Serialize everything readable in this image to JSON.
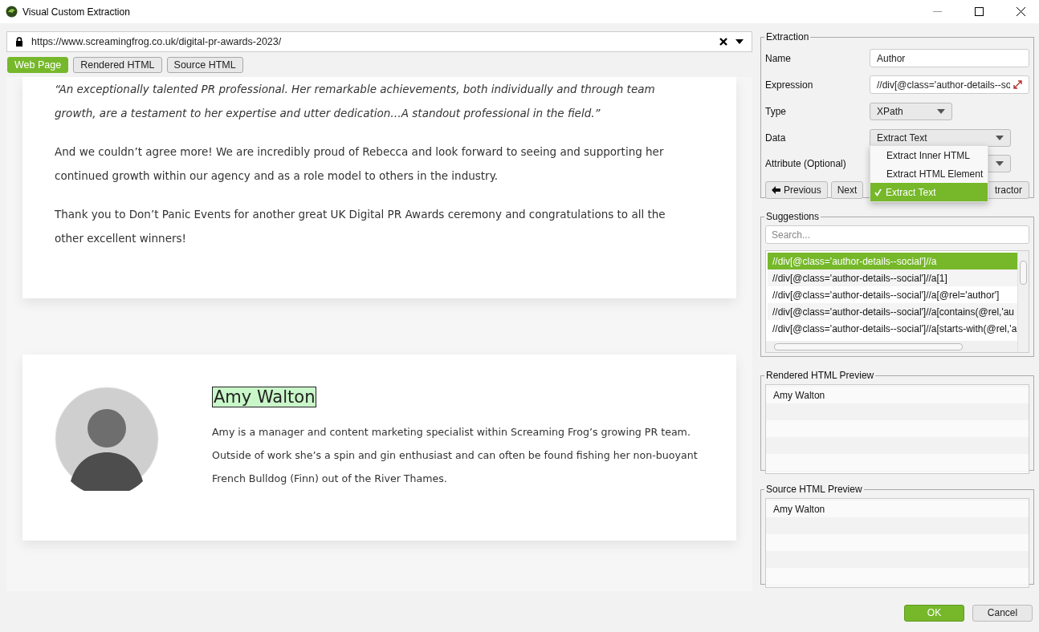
{
  "window": {
    "title": "Visual Custom Extraction"
  },
  "browser": {
    "url": "https://www.screamingfrog.co.uk/digital-pr-awards-2023/",
    "tabs": [
      {
        "label": "Web Page",
        "selected": true
      },
      {
        "label": "Rendered HTML",
        "selected": false
      },
      {
        "label": "Source HTML",
        "selected": false
      }
    ],
    "article": {
      "quote": "“An exceptionally talented PR professional. Her remarkable achievements, both individually and through team growth, are a testament to her expertise and utter dedication…A standout professional in the field.”",
      "paragraphs": [
        "And we couldn’t agree more! We are incredibly proud of Rebecca and look forward to seeing and supporting her continued growth within our agency and as a role model to others in the industry.",
        "Thank you to Don’t Panic Events for another great UK Digital PR Awards ceremony and congratulations to all the other excellent winners!"
      ],
      "author": {
        "name": "Amy Walton",
        "highlighted": true,
        "bio": "Amy is a manager and content marketing specialist within Screaming Frog’s growing PR team. Outside of work she’s a spin and gin enthusiast and can often be found fishing her non-buoyant French Bulldog (Finn) out of the River Thames."
      }
    }
  },
  "extraction": {
    "legend": "Extraction",
    "fields": [
      {
        "kind": "text",
        "label": "Name",
        "value": "Author"
      },
      {
        "kind": "expression",
        "label": "Expression",
        "value": "//div[@class='author-details--so"
      },
      {
        "kind": "select",
        "label": "Type",
        "value": "XPath"
      },
      {
        "kind": "select",
        "label": "Data",
        "value": "Extract Text"
      },
      {
        "kind": "select",
        "label": "Attribute (Optional)"
      }
    ],
    "menu": [
      {
        "label": "Extract Inner HTML",
        "selected": false
      },
      {
        "label": "Extract HTML Element",
        "selected": false
      },
      {
        "label": "Extract Text",
        "selected": true
      }
    ],
    "buttons": [
      {
        "kind": "previous",
        "label": "Previous"
      },
      {
        "kind": "next",
        "label": "Next"
      },
      {
        "kind": "plain",
        "label": "tractor"
      }
    ]
  },
  "suggestions": {
    "legend": "Suggestions",
    "placeholder": "Search...",
    "items": [
      {
        "text": "//div[@class='author-details--social']//a",
        "selected": true
      },
      {
        "text": "//div[@class='author-details--social']//a[1]",
        "selected": false
      },
      {
        "text": "//div[@class='author-details--social']//a[@rel='author']",
        "selected": false
      },
      {
        "text": "//div[@class='author-details--social']//a[contains(@rel,'au",
        "selected": false
      },
      {
        "text": "//div[@class='author-details--social']//a[starts-with(@rel,'a",
        "selected": false
      }
    ]
  },
  "rendered_preview": {
    "legend": "Rendered HTML Preview",
    "rows": [
      "Amy Walton"
    ]
  },
  "source_preview": {
    "legend": "Source HTML Preview",
    "rows": [
      "Amy Walton"
    ]
  },
  "dialog_buttons": [
    {
      "kind": "primary",
      "label": "OK"
    },
    {
      "kind": "secondary",
      "label": "Cancel"
    }
  ]
}
